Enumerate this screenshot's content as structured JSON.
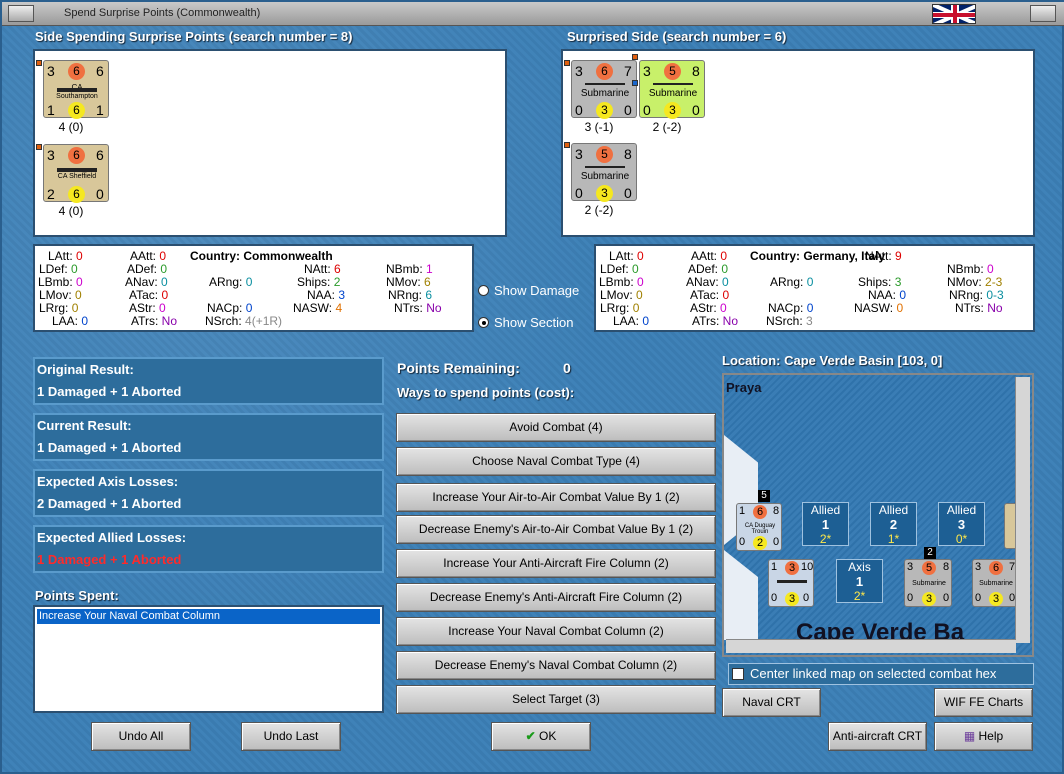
{
  "window": {
    "title": "Spend Surprise Points (Commonwealth)"
  },
  "spending": {
    "header": "Side Spending Surprise Points (search number = 8)",
    "units": [
      {
        "top_left": "3",
        "top_mid": "6",
        "top_right": "6",
        "type": "CA",
        "name": "Southampton",
        "bot_left": "1",
        "bot_mid": "6",
        "bot_right": "1",
        "value": "4 (0)"
      },
      {
        "top_left": "3",
        "top_mid": "6",
        "top_right": "6",
        "type": "",
        "name": "CA Sheffield",
        "bot_left": "2",
        "bot_mid": "6",
        "bot_right": "0",
        "value": "4 (0)"
      }
    ],
    "stats": {
      "country_label": "Country:",
      "country": "Commonwealth",
      "latt": "0",
      "ldef": "0",
      "lbmb": "0",
      "lmov": "0",
      "lrrg": "0",
      "laa": "0",
      "aatt": "0",
      "adef": "0",
      "anav": "0",
      "atac": "0",
      "astr": "0",
      "atrs": "No",
      "arng": "0",
      "nacp": "0",
      "nsrch": "4(+1R)",
      "natt": "6",
      "ships": "2",
      "naa": "3",
      "nasw": "4",
      "nbmb": "1",
      "nmov": "6",
      "nrng": "6",
      "ntrs": "No"
    }
  },
  "surprised": {
    "header": "Surprised Side (search number = 6)",
    "units": [
      {
        "top_left": "3",
        "top_mid": "6",
        "top_right": "7",
        "name": "Submarine",
        "bot_left": "0",
        "bot_mid": "3",
        "bot_right": "0",
        "value": "3 (-1)"
      },
      {
        "top_left": "3",
        "top_mid": "5",
        "top_right": "8",
        "name": "Submarine",
        "bot_left": "0",
        "bot_mid": "3",
        "bot_right": "0",
        "value": "2 (-2)"
      },
      {
        "top_left": "3",
        "top_mid": "5",
        "top_right": "8",
        "name": "Submarine",
        "bot_left": "0",
        "bot_mid": "3",
        "bot_right": "0",
        "value": "2 (-2)"
      }
    ],
    "stats": {
      "country_label": "Country:",
      "country": "Germany, Italy",
      "latt": "0",
      "ldef": "0",
      "lbmb": "0",
      "lmov": "0",
      "lrrg": "0",
      "laa": "0",
      "aatt": "0",
      "adef": "0",
      "anav": "0",
      "atac": "0",
      "astr": "0",
      "atrs": "No",
      "arng": "0",
      "nacp": "0",
      "nsrch": "3",
      "natt": "9",
      "ships": "3",
      "naa": "0",
      "nasw": "0",
      "nbmb": "0",
      "nmov": "2-3",
      "nrng": "0-3",
      "ntrs": "No"
    }
  },
  "stat_labels": {
    "latt": "LAtt:",
    "ldef": "LDef:",
    "lbmb": "LBmb:",
    "lmov": "LMov:",
    "lrrg": "LRrg:",
    "laa": "LAA:",
    "aatt": "AAtt:",
    "adef": "ADef:",
    "anav": "ANav:",
    "atac": "ATac:",
    "astr": "AStr:",
    "atrs": "ATrs:",
    "arng": "ARng:",
    "nacp": "NACp:",
    "nsrch": "NSrch:",
    "natt": "NAtt:",
    "ships": "Ships:",
    "naa": "NAA:",
    "nasw": "NASW:",
    "nbmb": "NBmb:",
    "nmov": "NMov:",
    "nrng": "NRng:",
    "ntrs": "NTrs:"
  },
  "options": {
    "show_damage": "Show Damage",
    "show_section": "Show Section",
    "selected": "show_section"
  },
  "results": [
    {
      "title": "Original Result:",
      "value": "1 Damaged + 1 Aborted"
    },
    {
      "title": "Current Result:",
      "value": "1 Damaged + 1 Aborted"
    },
    {
      "title": "Expected Axis Losses:",
      "value": "2 Damaged + 1 Aborted"
    },
    {
      "title": "Expected Allied Losses:",
      "value": "1 Damaged + 1 Aborted"
    }
  ],
  "points_spent": {
    "title": "Points Spent:",
    "items": [
      "Increase Your Naval Combat Column"
    ]
  },
  "points_remaining": {
    "label": "Points Remaining:",
    "value": "0"
  },
  "ways_label": "Ways to spend points (cost):",
  "spend_options": [
    "Avoid Combat (4)",
    "Choose Naval Combat Type (4)",
    "Increase Your Air-to-Air Combat Value By 1 (2)",
    "Decrease Enemy's Air-to-Air Combat Value By 1 (2)",
    "Increase Your Anti-Aircraft Fire Column (2)",
    "Decrease Enemy's Anti-Aircraft Fire Column (2)",
    "Increase Your Naval Combat Column (2)",
    "Decrease Enemy's Naval Combat Column (2)",
    "Select Target (3)"
  ],
  "map": {
    "location": "Location: Cape Verde Basin [103, 0]",
    "praya": "Praya",
    "big_label": "Cape Verde Ba",
    "boxes": [
      {
        "title": "Allied",
        "num": "1",
        "val": "2*"
      },
      {
        "title": "Allied",
        "num": "2",
        "val": "1*"
      },
      {
        "title": "Allied",
        "num": "3",
        "val": "0*"
      },
      {
        "title": "Axis",
        "num": "1",
        "val": "2*"
      }
    ],
    "map_units": [
      {
        "stack": "5",
        "top_left": "1",
        "top_mid": "6",
        "top_right": "8",
        "name": "CA Duguay Trouin",
        "bot_left": "0",
        "bot_mid": "2",
        "bot_right": "0"
      },
      {
        "stack": "",
        "top_left": "1",
        "top_mid": "3",
        "top_right": "10",
        "name": "",
        "bot_left": "0",
        "bot_mid": "3",
        "bot_right": "0"
      },
      {
        "stack": "2",
        "top_left": "3",
        "top_mid": "5",
        "top_right": "8",
        "name": "Submarine",
        "bot_left": "0",
        "bot_mid": "3",
        "bot_right": "0"
      },
      {
        "stack": "",
        "top_left": "3",
        "top_mid": "6",
        "top_right": "7",
        "name": "Submarine",
        "bot_left": "0",
        "bot_mid": "3",
        "bot_right": "0"
      }
    ]
  },
  "center_linked": "Center linked map on selected combat hex",
  "buttons": {
    "undo_all": "Undo All",
    "undo_last": "Undo Last",
    "ok": "OK",
    "naval_crt": "Naval CRT",
    "wif_charts": "WIF FE Charts",
    "aa_crt": "Anti-aircraft CRT",
    "help": "Help"
  },
  "colors": {
    "accent": "#3d7fb5",
    "counter_tan": "#d8c79a",
    "counter_grey": "#b8b8b8",
    "counter_green": "#c8f06a",
    "red_text": "#ff2a2a"
  }
}
